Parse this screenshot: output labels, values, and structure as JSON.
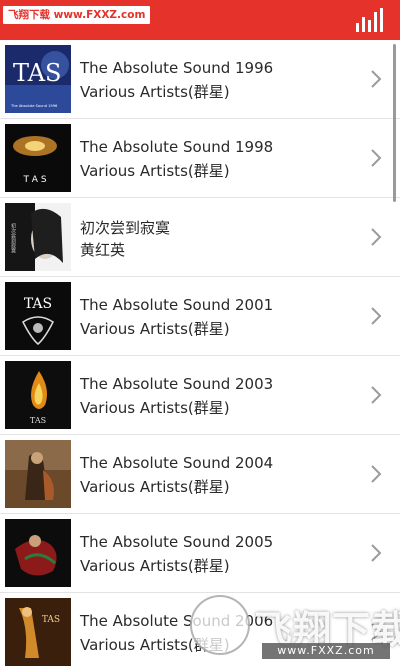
{
  "header": {
    "watermark_tag": "飞翔下载 www.FXXZ.com",
    "eq_icon": "equalizer-icon",
    "background_color": "#e5322b"
  },
  "albums": [
    {
      "title": "The Absolute Sound 1996",
      "artist": "Various Artists(群星)"
    },
    {
      "title": "The Absolute Sound 1998",
      "artist": "Various Artists(群星)"
    },
    {
      "title": "初次尝到寂寞",
      "artist": "黄红英"
    },
    {
      "title": "The Absolute Sound 2001",
      "artist": "Various Artists(群星)"
    },
    {
      "title": "The Absolute Sound 2003",
      "artist": "Various Artists(群星)"
    },
    {
      "title": "The Absolute Sound 2004",
      "artist": "Various Artists(群星)"
    },
    {
      "title": "The Absolute Sound 2005",
      "artist": "Various Artists(群星)"
    },
    {
      "title": "The Absolute Sound 2006",
      "artist": "Various Artists(群星)"
    }
  ],
  "covers": {
    "tas_1996": {
      "text": "TAS",
      "caption": "The Absolute Sound 1996"
    },
    "tas_1998": {
      "text": "T A S"
    },
    "chinese": {
      "text": "初次尝到寂寞"
    },
    "tas_2001": {
      "text": "TAS"
    },
    "tas_2003": {
      "text": "TAS"
    },
    "tas_2006": {
      "text": "TAS"
    }
  },
  "watermark": {
    "brand": "飞翔下载",
    "domain": "www.FXXZ.com"
  }
}
